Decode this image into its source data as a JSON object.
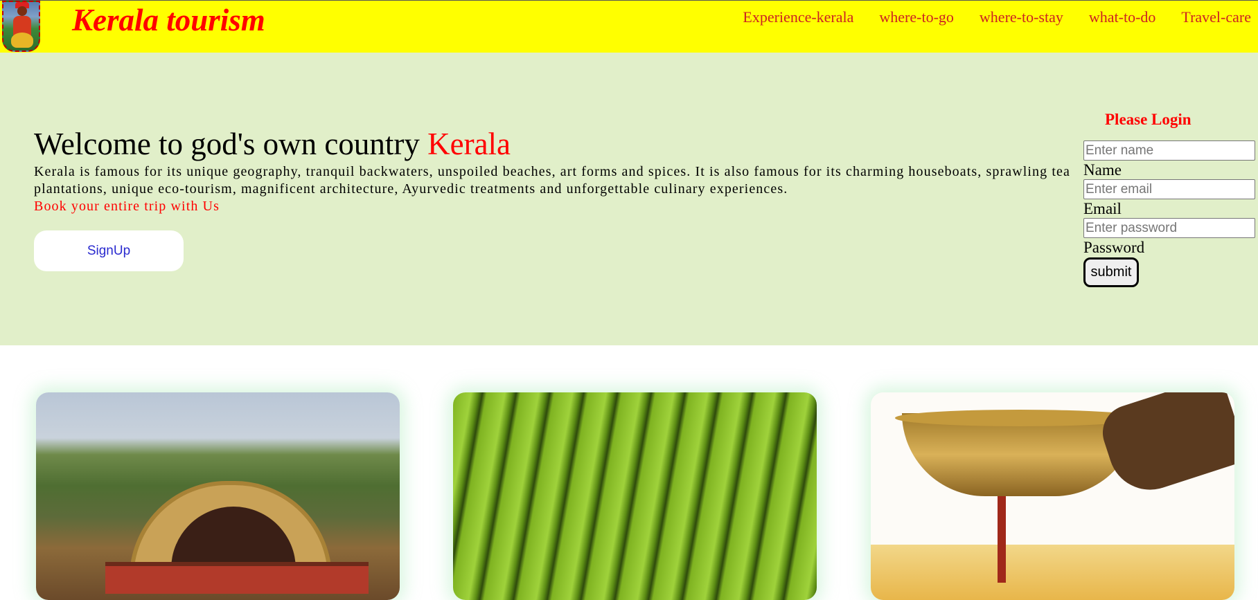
{
  "navbar": {
    "brand": "Kerala tourism",
    "links": [
      "Experience-kerala",
      "where-to-go",
      "where-to-stay",
      "what-to-do",
      "Travel-care"
    ]
  },
  "hero": {
    "title_prefix": "Welcome to god's own country ",
    "title_accent": "Kerala",
    "description": "Kerala is famous for its unique geography, tranquil backwaters, unspoiled beaches, art forms and spices. It is also famous for its charming houseboats, sprawling tea plantations, unique eco-tourism, magnificent architecture, Ayurvedic treatments and unforgettable culinary experiences.",
    "cta": "Book your entire trip with Us",
    "signup_label": "SignUp"
  },
  "login": {
    "title": "Please Login",
    "name_placeholder": "Enter name",
    "name_label": "Name",
    "email_placeholder": "Enter email",
    "email_label": "Email",
    "password_placeholder": "Enter password",
    "password_label": "Password",
    "submit_label": "submit"
  },
  "colors": {
    "navbar_bg": "#ffff00",
    "brand": "#ff0000",
    "nav_link": "#cc2222",
    "hero_bg": "#e1efc9",
    "accent": "#ff0000"
  },
  "cards": [
    {
      "image": "houseboat-image"
    },
    {
      "image": "tea-plantation-image"
    },
    {
      "image": "ayurveda-oil-pot-image"
    }
  ]
}
